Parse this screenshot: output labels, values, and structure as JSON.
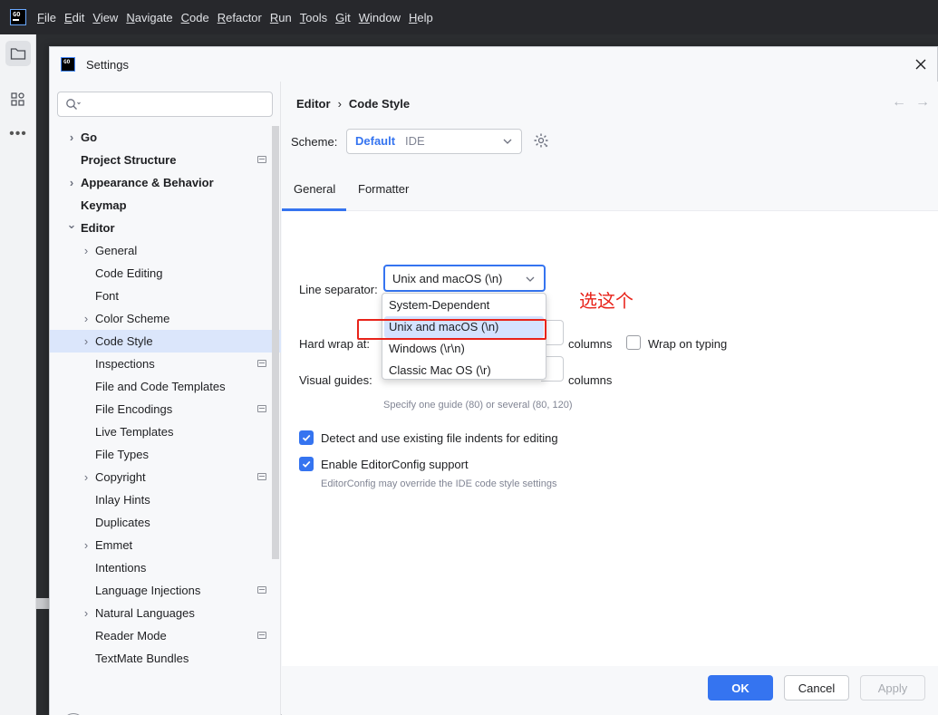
{
  "ide": {
    "logo_text": "GO",
    "menu": [
      "File",
      "Edit",
      "View",
      "Navigate",
      "Code",
      "Refactor",
      "Run",
      "Tools",
      "Git",
      "Window",
      "Help"
    ],
    "menu_mnemonics": [
      "F",
      "E",
      "V",
      "N",
      "C",
      "R",
      "R",
      "T",
      "G",
      "W",
      "H"
    ]
  },
  "dialog": {
    "title": "Settings",
    "search": {
      "value": "",
      "placeholder": ""
    }
  },
  "nav": {
    "items": [
      {
        "label": "Go",
        "level": 0,
        "expandable": true,
        "expanded": false,
        "bold": true,
        "project": false
      },
      {
        "label": "Project Structure",
        "level": 0,
        "expandable": false,
        "bold": true,
        "project": true
      },
      {
        "label": "Appearance & Behavior",
        "level": 0,
        "expandable": true,
        "expanded": false,
        "bold": true,
        "project": false
      },
      {
        "label": "Keymap",
        "level": 0,
        "expandable": false,
        "bold": true,
        "project": false
      },
      {
        "label": "Editor",
        "level": 0,
        "expandable": true,
        "expanded": true,
        "bold": true,
        "project": false
      },
      {
        "label": "General",
        "level": 1,
        "expandable": true,
        "expanded": false,
        "bold": false,
        "project": false
      },
      {
        "label": "Code Editing",
        "level": 1,
        "expandable": false,
        "bold": false,
        "project": false
      },
      {
        "label": "Font",
        "level": 1,
        "expandable": false,
        "bold": false,
        "project": false
      },
      {
        "label": "Color Scheme",
        "level": 1,
        "expandable": true,
        "expanded": false,
        "bold": false,
        "project": false
      },
      {
        "label": "Code Style",
        "level": 1,
        "expandable": true,
        "expanded": false,
        "bold": false,
        "project": false,
        "selected": true
      },
      {
        "label": "Inspections",
        "level": 1,
        "expandable": false,
        "bold": false,
        "project": true
      },
      {
        "label": "File and Code Templates",
        "level": 1,
        "expandable": false,
        "bold": false,
        "project": false
      },
      {
        "label": "File Encodings",
        "level": 1,
        "expandable": false,
        "bold": false,
        "project": true
      },
      {
        "label": "Live Templates",
        "level": 1,
        "expandable": false,
        "bold": false,
        "project": false
      },
      {
        "label": "File Types",
        "level": 1,
        "expandable": false,
        "bold": false,
        "project": false
      },
      {
        "label": "Copyright",
        "level": 1,
        "expandable": true,
        "expanded": false,
        "bold": false,
        "project": true
      },
      {
        "label": "Inlay Hints",
        "level": 1,
        "expandable": false,
        "bold": false,
        "project": false
      },
      {
        "label": "Duplicates",
        "level": 1,
        "expandable": false,
        "bold": false,
        "project": false
      },
      {
        "label": "Emmet",
        "level": 1,
        "expandable": true,
        "expanded": false,
        "bold": false,
        "project": false
      },
      {
        "label": "Intentions",
        "level": 1,
        "expandable": false,
        "bold": false,
        "project": false
      },
      {
        "label": "Language Injections",
        "level": 1,
        "expandable": false,
        "bold": false,
        "project": true
      },
      {
        "label": "Natural Languages",
        "level": 1,
        "expandable": true,
        "expanded": false,
        "bold": false,
        "project": false
      },
      {
        "label": "Reader Mode",
        "level": 1,
        "expandable": false,
        "bold": false,
        "project": true
      },
      {
        "label": "TextMate Bundles",
        "level": 1,
        "expandable": false,
        "bold": false,
        "project": false
      }
    ]
  },
  "content": {
    "breadcrumb": {
      "parent": "Editor",
      "separator": "›",
      "current": "Code Style"
    },
    "scheme": {
      "label": "Scheme:",
      "value": "Default",
      "sub": "IDE"
    },
    "tabs": [
      {
        "label": "General",
        "active": true
      },
      {
        "label": "Formatter",
        "active": false
      }
    ],
    "line_separator": {
      "label": "Line separator:",
      "value": "Unix and macOS (\\n)",
      "options": [
        "System-Dependent",
        "Unix and macOS (\\n)",
        "Windows (\\r\\n)",
        "Classic Mac OS (\\r)"
      ],
      "selected_index": 1
    },
    "hard_wrap": {
      "label": "Hard wrap at:",
      "value": "",
      "columns_label": "columns",
      "wrap_on_typing_label": "Wrap on typing",
      "wrap_on_typing": false
    },
    "visual_guides": {
      "label": "Visual guides:",
      "value": "",
      "columns_label": "columns",
      "hint": "Specify one guide (80) or several (80, 120)"
    },
    "detect_indents": {
      "label": "Detect and use existing file indents for editing",
      "checked": true
    },
    "editorconfig": {
      "label": "Enable EditorConfig support",
      "checked": true,
      "hint": "EditorConfig may override the IDE code style settings"
    }
  },
  "annotation": {
    "text": "选这个",
    "color": "#e8231a"
  },
  "footer": {
    "ok": "OK",
    "cancel": "Cancel",
    "apply": "Apply"
  },
  "colors": {
    "accent": "#3574f0",
    "selection": "#dbe6fb",
    "annotation_red": "#e8231a"
  },
  "icons": [
    "go-logo-icon",
    "folder-icon",
    "structure-icon",
    "more-icon",
    "close-icon",
    "search-icon",
    "chevron-right-icon",
    "chevron-down-icon",
    "project-scope-icon",
    "gear-icon",
    "arrow-left-icon",
    "arrow-right-icon",
    "checkmark-icon",
    "help-icon"
  ]
}
